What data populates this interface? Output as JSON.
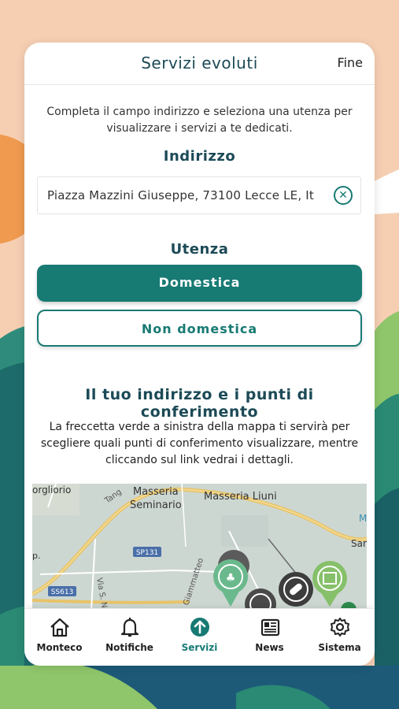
{
  "header": {
    "title": "Servizi evoluti",
    "done_label": "Fine"
  },
  "intro_text": "Completa il campo indirizzo e seleziona una utenza per visualizzare i servizi a te dedicati.",
  "address": {
    "heading": "Indirizzo",
    "value": "Piazza Mazzini Giuseppe, 73100 Lecce LE, It"
  },
  "utenza": {
    "heading": "Utenza",
    "options": [
      "Domestica",
      "Non domestica"
    ],
    "selected": "Domestica"
  },
  "map_section": {
    "heading": "Il tuo indirizzo e i punti di conferimento",
    "description": "La freccetta verde a sinistra della mappa ti servirà per scegliere quali punti di conferimento visualizzare, mentre cliccando sul link vedrai i dettagli.",
    "labels": {
      "l1": "orgliorio",
      "l2": "Masseria",
      "l3": "Seminario",
      "l4": "Masseria Liuni",
      "l5": "SP131",
      "l6": "SS613",
      "l7": "Via S. Nicola",
      "l8": "Giammatteo",
      "l9": "Tang",
      "l10": "Sar",
      "l11": "M",
      "l12": "p."
    }
  },
  "tabs": [
    {
      "label": "Monteco",
      "icon": "home-icon"
    },
    {
      "label": "Notifiche",
      "icon": "bell-icon"
    },
    {
      "label": "Servizi",
      "icon": "arrow-up-circle-icon"
    },
    {
      "label": "News",
      "icon": "newspaper-icon"
    },
    {
      "label": "Sistema",
      "icon": "gear-icon"
    }
  ],
  "active_tab": "Servizi",
  "colors": {
    "accent": "#177a73",
    "title": "#1c4a57",
    "background_peach": "#f6cfb3"
  }
}
